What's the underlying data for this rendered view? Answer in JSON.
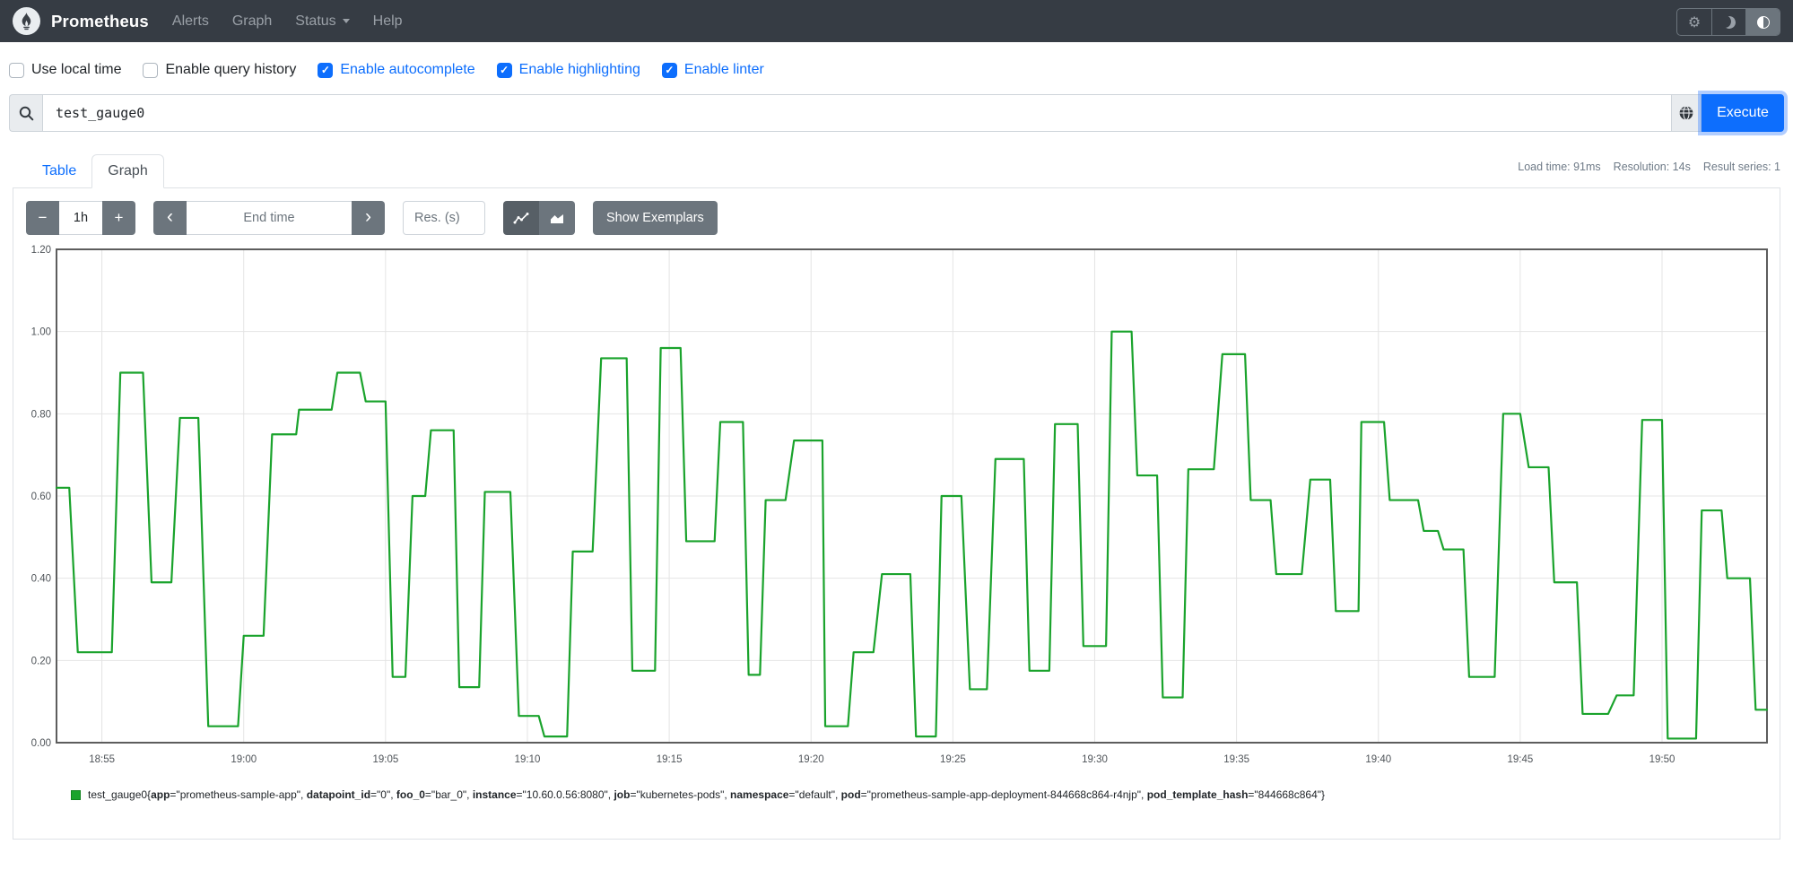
{
  "navbar": {
    "brand": "Prometheus",
    "items": [
      {
        "label": "Alerts",
        "caret": false
      },
      {
        "label": "Graph",
        "caret": false
      },
      {
        "label": "Status",
        "caret": true
      },
      {
        "label": "Help",
        "caret": false
      }
    ],
    "theme_buttons": [
      {
        "name": "settings",
        "active": false
      },
      {
        "name": "dark-theme",
        "active": false
      },
      {
        "name": "auto-theme",
        "active": true
      }
    ]
  },
  "options": [
    {
      "label": "Use local time",
      "checked": false
    },
    {
      "label": "Enable query history",
      "checked": false
    },
    {
      "label": "Enable autocomplete",
      "checked": true
    },
    {
      "label": "Enable highlighting",
      "checked": true
    },
    {
      "label": "Enable linter",
      "checked": true
    }
  ],
  "query": {
    "value": "test_gauge0",
    "execute_label": "Execute"
  },
  "tabs": [
    {
      "label": "Table",
      "active": false
    },
    {
      "label": "Graph",
      "active": true
    }
  ],
  "stats": {
    "load_time": "Load time: 91ms",
    "resolution": "Resolution: 14s",
    "result_series": "Result series: 1"
  },
  "controls": {
    "minus_label": "−",
    "range_value": "1h",
    "plus_label": "+",
    "prev_label": "‹",
    "end_time_placeholder": "End time",
    "next_label": "›",
    "res_placeholder": "Res. (s)",
    "show_exemplars_label": "Show Exemplars"
  },
  "chart_data": {
    "type": "line",
    "line_color": "#1aa32c",
    "grid": true,
    "ylim": [
      0,
      1.2
    ],
    "x_minutes_range": [
      0,
      60.3
    ],
    "y_ticks": [
      {
        "v": 0.0,
        "label": "0.00"
      },
      {
        "v": 0.2,
        "label": "0.20"
      },
      {
        "v": 0.4,
        "label": "0.40"
      },
      {
        "v": 0.6,
        "label": "0.60"
      },
      {
        "v": 0.8,
        "label": "0.80"
      },
      {
        "v": 1.0,
        "label": "1.00"
      },
      {
        "v": 1.2,
        "label": "1.20"
      }
    ],
    "x_ticks": [
      {
        "t": 1.6,
        "label": "18:55"
      },
      {
        "t": 6.6,
        "label": "19:00"
      },
      {
        "t": 11.6,
        "label": "19:05"
      },
      {
        "t": 16.6,
        "label": "19:10"
      },
      {
        "t": 21.6,
        "label": "19:15"
      },
      {
        "t": 26.6,
        "label": "19:20"
      },
      {
        "t": 31.6,
        "label": "19:25"
      },
      {
        "t": 36.6,
        "label": "19:30"
      },
      {
        "t": 41.6,
        "label": "19:35"
      },
      {
        "t": 46.6,
        "label": "19:40"
      },
      {
        "t": 51.6,
        "label": "19:45"
      },
      {
        "t": 56.6,
        "label": "19:50"
      }
    ],
    "series": [
      {
        "name": "test_gauge0",
        "plateaus": [
          [
            0.0,
            0.45,
            0.62
          ],
          [
            0.75,
            1.95,
            0.22
          ],
          [
            2.25,
            3.05,
            0.9
          ],
          [
            3.35,
            4.05,
            0.39
          ],
          [
            4.35,
            5.0,
            0.79
          ],
          [
            5.35,
            6.4,
            0.04
          ],
          [
            6.6,
            7.3,
            0.26
          ],
          [
            7.6,
            8.45,
            0.75
          ],
          [
            8.55,
            9.7,
            0.81
          ],
          [
            9.9,
            10.7,
            0.9
          ],
          [
            10.9,
            11.6,
            0.83
          ],
          [
            11.85,
            12.3,
            0.16
          ],
          [
            12.55,
            13.0,
            0.6
          ],
          [
            13.2,
            14.0,
            0.76
          ],
          [
            14.2,
            14.9,
            0.135
          ],
          [
            15.1,
            16.0,
            0.61
          ],
          [
            16.3,
            17.0,
            0.065
          ],
          [
            17.2,
            18.0,
            0.015
          ],
          [
            18.2,
            18.9,
            0.465
          ],
          [
            19.2,
            20.1,
            0.935
          ],
          [
            20.3,
            21.1,
            0.175
          ],
          [
            21.3,
            22.0,
            0.96
          ],
          [
            22.2,
            23.2,
            0.49
          ],
          [
            23.4,
            24.2,
            0.78
          ],
          [
            24.4,
            24.8,
            0.165
          ],
          [
            25.0,
            25.7,
            0.59
          ],
          [
            26.0,
            27.0,
            0.735
          ],
          [
            27.1,
            27.9,
            0.04
          ],
          [
            28.1,
            28.8,
            0.22
          ],
          [
            29.1,
            30.1,
            0.41
          ],
          [
            30.3,
            31.0,
            0.015
          ],
          [
            31.2,
            31.9,
            0.6
          ],
          [
            32.2,
            32.8,
            0.13
          ],
          [
            33.1,
            34.1,
            0.69
          ],
          [
            34.3,
            35.0,
            0.175
          ],
          [
            35.2,
            36.0,
            0.775
          ],
          [
            36.2,
            37.0,
            0.235
          ],
          [
            37.2,
            37.9,
            1.0
          ],
          [
            38.1,
            38.8,
            0.65
          ],
          [
            39.0,
            39.7,
            0.11
          ],
          [
            39.9,
            40.8,
            0.665
          ],
          [
            41.1,
            41.9,
            0.945
          ],
          [
            42.1,
            42.8,
            0.59
          ],
          [
            43.0,
            43.9,
            0.41
          ],
          [
            44.2,
            44.9,
            0.64
          ],
          [
            45.1,
            45.9,
            0.32
          ],
          [
            46.0,
            46.8,
            0.78
          ],
          [
            47.0,
            48.0,
            0.59
          ],
          [
            48.2,
            48.7,
            0.515
          ],
          [
            48.9,
            49.6,
            0.47
          ],
          [
            49.8,
            50.7,
            0.16
          ],
          [
            51.0,
            51.6,
            0.8
          ],
          [
            51.9,
            52.6,
            0.67
          ],
          [
            52.8,
            53.6,
            0.39
          ],
          [
            53.8,
            54.7,
            0.07
          ],
          [
            55.0,
            55.6,
            0.115
          ],
          [
            55.9,
            56.6,
            0.785
          ],
          [
            56.8,
            57.8,
            0.01
          ],
          [
            58.0,
            58.7,
            0.565
          ],
          [
            58.9,
            59.7,
            0.4
          ],
          [
            59.9,
            60.3,
            0.08
          ]
        ]
      }
    ]
  },
  "legend": {
    "series_name": "test_gauge0",
    "labels": [
      {
        "key": "app",
        "value": "prometheus-sample-app"
      },
      {
        "key": "datapoint_id",
        "value": "0"
      },
      {
        "key": "foo_0",
        "value": "bar_0"
      },
      {
        "key": "instance",
        "value": "10.60.0.56:8080"
      },
      {
        "key": "job",
        "value": "kubernetes-pods"
      },
      {
        "key": "namespace",
        "value": "default"
      },
      {
        "key": "pod",
        "value": "prometheus-sample-app-deployment-844668c864-r4njp"
      },
      {
        "key": "pod_template_hash",
        "value": "844668c864"
      }
    ]
  }
}
